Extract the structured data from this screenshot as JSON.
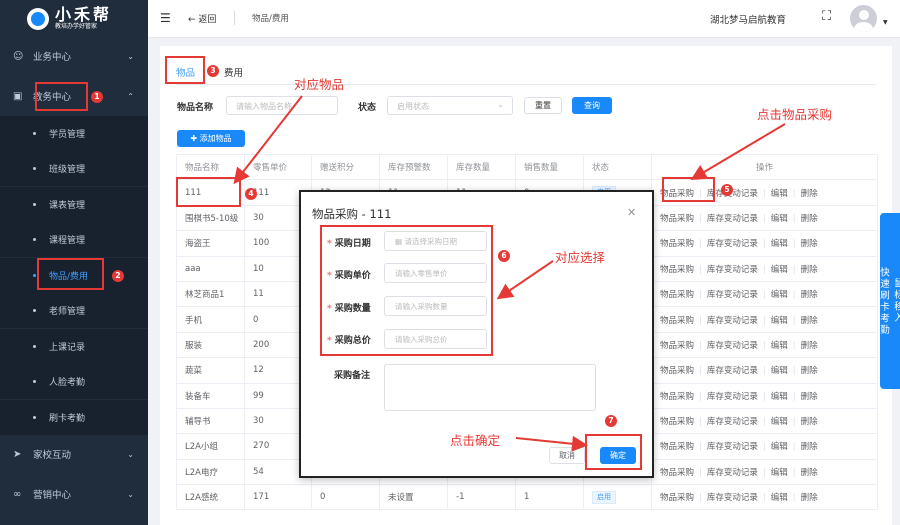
{
  "app": {
    "name": "小禾帮",
    "tagline": "教培办学好管家"
  },
  "sidebar": {
    "groups": [
      {
        "label": "业务中心",
        "icon": "user-icon"
      },
      {
        "label": "教务中心",
        "icon": "book-icon"
      },
      {
        "label": "家校互动",
        "icon": "send-icon"
      },
      {
        "label": "营销中心",
        "icon": "share-icon"
      }
    ],
    "edu_items": [
      "学员管理",
      "班级管理",
      "课表管理",
      "课程管理",
      "物品/费用",
      "老师管理",
      "上课记录",
      "人脸考勤",
      "刷卡考勤"
    ],
    "active_item": "物品/费用"
  },
  "topbar": {
    "back": "返回",
    "breadcrumb": "物品/费用",
    "org": "湖北梦马启航教育"
  },
  "tabs": [
    "物品",
    "费用"
  ],
  "filters": {
    "name_label": "物品名称",
    "name_placeholder": "请输入物品名称",
    "status_label": "状态",
    "status_placeholder": "启用状态",
    "reset": "重置",
    "search": "查询"
  },
  "add_button": "添加物品",
  "table": {
    "headers": [
      "物品名称",
      "零售单价",
      "赠送积分",
      "库存预警数",
      "库存数量",
      "销售数量",
      "状态",
      "操作"
    ],
    "rows": [
      [
        "111",
        "111",
        "12",
        "11",
        "11",
        "0"
      ],
      [
        "围棋书5-10级",
        "30",
        "",
        "",
        "",
        ""
      ],
      [
        "海盗王",
        "100",
        "",
        "",
        "",
        ""
      ],
      [
        "aaa",
        "10",
        "",
        "",
        "",
        ""
      ],
      [
        "林芝商品1",
        "11",
        "",
        "",
        "",
        ""
      ],
      [
        "手机",
        "0",
        "",
        "",
        "",
        ""
      ],
      [
        "服装",
        "200",
        "",
        "",
        "",
        ""
      ],
      [
        "蔬菜",
        "12",
        "",
        "",
        "",
        ""
      ],
      [
        "装备车",
        "99",
        "",
        "",
        "",
        ""
      ],
      [
        "辅导书",
        "30",
        "",
        "",
        "",
        ""
      ],
      [
        "L2A小组",
        "270",
        "",
        "",
        "",
        ""
      ],
      [
        "L2A电疗",
        "54",
        "",
        "",
        "",
        ""
      ],
      [
        "L2A感统",
        "171",
        "0",
        "未设置",
        "-1",
        "1"
      ]
    ],
    "status_tag": "启用",
    "ops": [
      "物品采购",
      "库存变动记录",
      "编辑",
      "删除"
    ]
  },
  "side_float": [
    "鼠标移入",
    "快速刷卡考勤"
  ],
  "dialog": {
    "title": "物品采购 - 111",
    "fields": [
      {
        "label": "采购日期",
        "placeholder": "请选择采购日期",
        "required": true
      },
      {
        "label": "采购单价",
        "placeholder": "请输入零售单价",
        "required": true
      },
      {
        "label": "采购数量",
        "placeholder": "请输入采购数量",
        "required": true
      },
      {
        "label": "采购总价",
        "placeholder": "请输入采购总价",
        "required": true
      }
    ],
    "note_label": "采购备注",
    "cancel": "取消",
    "confirm": "确定"
  },
  "annotations": {
    "numbers": [
      "1",
      "2",
      "3",
      "4",
      "5",
      "6",
      "7"
    ],
    "item_hint": "对应物品",
    "purchase_hint": "点击物品采购",
    "select_hint": "对应选择",
    "confirm_hint": "点击确定"
  },
  "colors": {
    "primary": "#1989fa",
    "sidebar": "#1f2d3d",
    "annotation": "#e53935"
  }
}
